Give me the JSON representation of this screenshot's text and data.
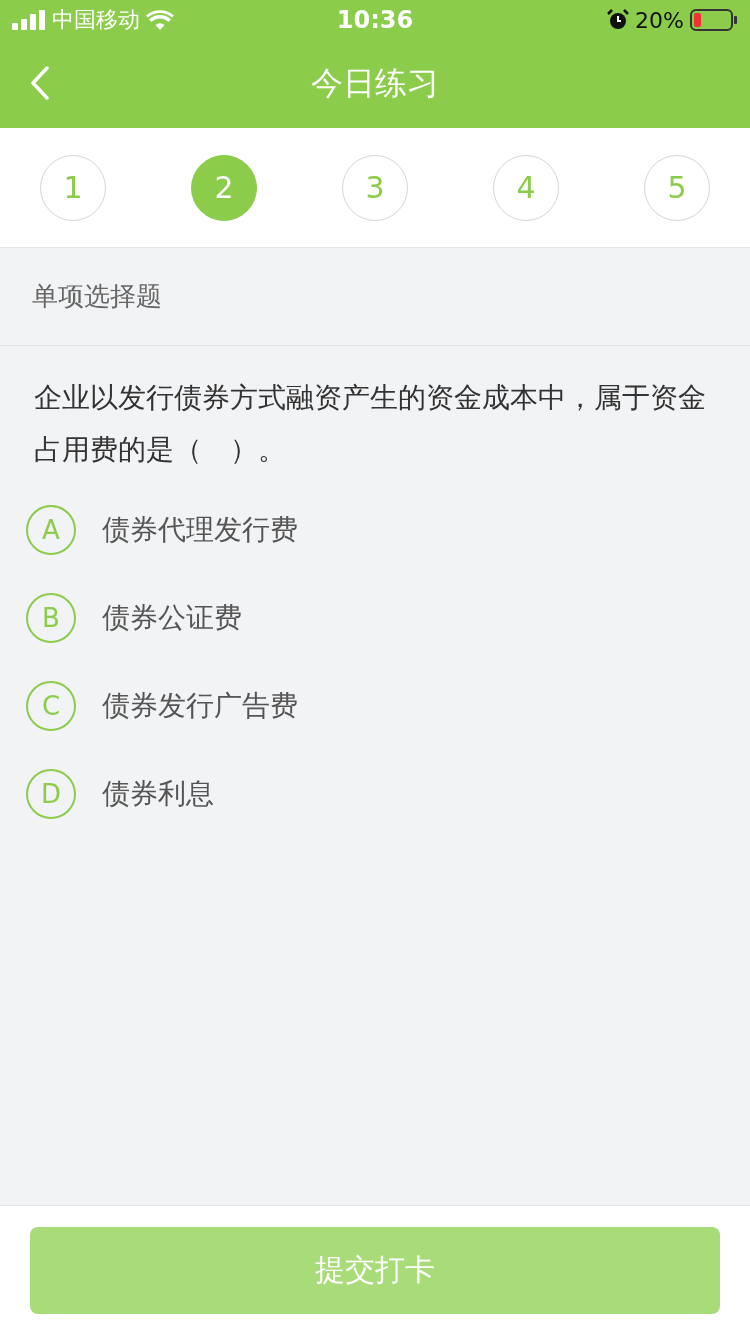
{
  "status_bar": {
    "carrier": "中国移动",
    "time": "10:36",
    "battery": "20%"
  },
  "nav": {
    "title": "今日练习"
  },
  "steps": [
    {
      "label": "1",
      "selected": false
    },
    {
      "label": "2",
      "selected": true
    },
    {
      "label": "3",
      "selected": false
    },
    {
      "label": "4",
      "selected": false
    },
    {
      "label": "5",
      "selected": false
    }
  ],
  "section": {
    "title": "单项选择题"
  },
  "question": {
    "text": "企业以发行债券方式融资产生的资金成本中，属于资金占用费的是（　）。"
  },
  "options": [
    {
      "letter": "A",
      "text": "债券代理发行费",
      "selected": false
    },
    {
      "letter": "B",
      "text": "债券公证费",
      "selected": false
    },
    {
      "letter": "C",
      "text": "债券发行广告费",
      "selected": false
    },
    {
      "letter": "D",
      "text": "债券利息",
      "selected": false
    }
  ],
  "submit": {
    "label": "提交打卡",
    "disabled": true
  }
}
